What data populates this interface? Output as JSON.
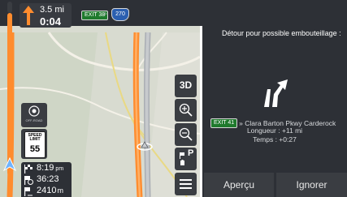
{
  "instruction": {
    "distance": "3.5 mi",
    "time_to_turn": "0:04",
    "exit_badge": "EXIT 38",
    "separator": "»",
    "route_shield": "270"
  },
  "widgets": {
    "offroad_label": "OFF-ROAD",
    "speed_limit_label": "SPEED LIMIT",
    "speed_limit_value": "55"
  },
  "stats": {
    "eta": "8:19",
    "eta_suffix": "pm",
    "remaining_time": "36:23",
    "remaining_distance": "2410",
    "remaining_distance_unit": "m"
  },
  "map_buttons": {
    "view_mode": "3D",
    "parking_label": "P"
  },
  "detour_panel": {
    "title": "Détour pour possible embouteillage :",
    "exit_badge": "EXIT 41",
    "exit_road": "» Clara Barton Pkwy Carderock",
    "length_text": "Longueur : +11 mi",
    "time_text": "Temps : +0:27",
    "preview_button": "Aperçu",
    "ignore_button": "Ignorer"
  },
  "colors": {
    "route": "#ff8c2e",
    "exit_green": "#1f7a2d",
    "shield_blue": "#2b5fb0",
    "panel_bg": "#2d3036",
    "button_bg": "#3a3d42"
  }
}
